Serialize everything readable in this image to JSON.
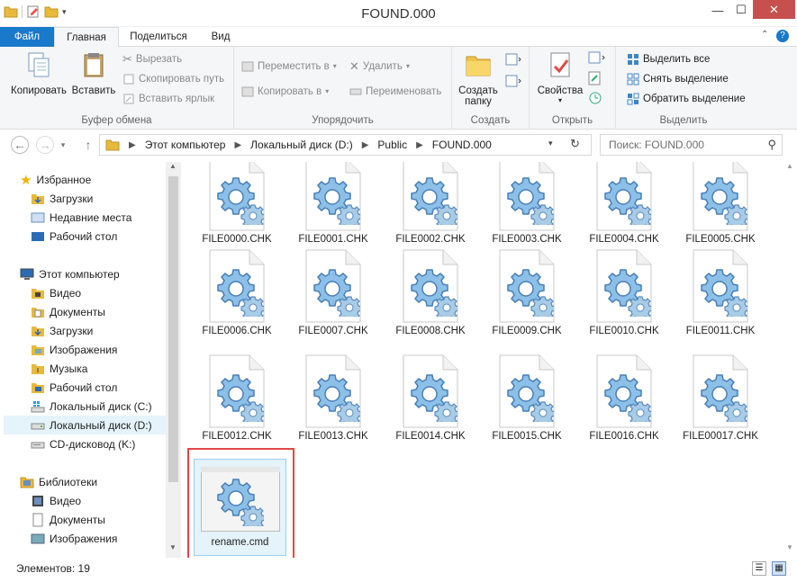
{
  "window": {
    "title": "FOUND.000",
    "minimize": "—",
    "maximize": "☐",
    "close": "✕"
  },
  "tabs": [
    {
      "label": "Файл"
    },
    {
      "label": "Главная"
    },
    {
      "label": "Поделиться"
    },
    {
      "label": "Вид"
    }
  ],
  "ribbon": {
    "clipboard": {
      "group_label": "Буфер обмена",
      "copy": "Копировать",
      "paste": "Вставить",
      "cut": "Вырезать",
      "copy_path": "Скопировать путь",
      "paste_shortcut": "Вставить ярлык"
    },
    "organize": {
      "group_label": "Упорядочить",
      "move_to": "Переместить в",
      "copy_to": "Копировать в",
      "delete": "Удалить",
      "rename": "Переименовать"
    },
    "new": {
      "group_label": "Создать",
      "new_folder_1": "Создать",
      "new_folder_2": "папку"
    },
    "open": {
      "group_label": "Открыть",
      "properties": "Свойства"
    },
    "select": {
      "group_label": "Выделить",
      "select_all": "Выделить все",
      "select_none": "Снять выделение",
      "invert": "Обратить выделение"
    }
  },
  "address": {
    "breadcrumb": [
      "Этот компьютер",
      "Локальный диск (D:)",
      "Public",
      "FOUND.000"
    ],
    "search_placeholder": "Поиск: FOUND.000"
  },
  "nav": {
    "favorites": "Избранное",
    "fav_items": [
      "Загрузки",
      "Недавние места",
      "Рабочий стол"
    ],
    "computer": "Этот компьютер",
    "computer_items": [
      "Видео",
      "Документы",
      "Загрузки",
      "Изображения",
      "Музыка",
      "Рабочий стол",
      "Локальный диск (C:)",
      "Локальный диск (D:)",
      "CD-дисковод (K:)"
    ],
    "libraries": "Библиотеки",
    "library_items": [
      "Видео",
      "Документы",
      "Изображения"
    ]
  },
  "files": [
    "FILE0000.CHK",
    "FILE0001.CHK",
    "FILE0002.CHK",
    "FILE0003.CHK",
    "FILE0004.CHK",
    "FILE0005.CHK",
    "FILE0006.CHK",
    "FILE0007.CHK",
    "FILE0008.CHK",
    "FILE0009.CHK",
    "FILE0010.CHK",
    "FILE0011.CHK",
    "FILE0012.CHK",
    "FILE0013.CHK",
    "FILE0014.CHK",
    "FILE0015.CHK",
    "FILE0016.CHK",
    "FILE00017.CHK"
  ],
  "selected_file": "rename.cmd",
  "status": {
    "count": "Элементов: 19"
  },
  "colors": {
    "accent": "#1979ca",
    "highlight": "#e04848",
    "selected": "#e5f3fb"
  }
}
